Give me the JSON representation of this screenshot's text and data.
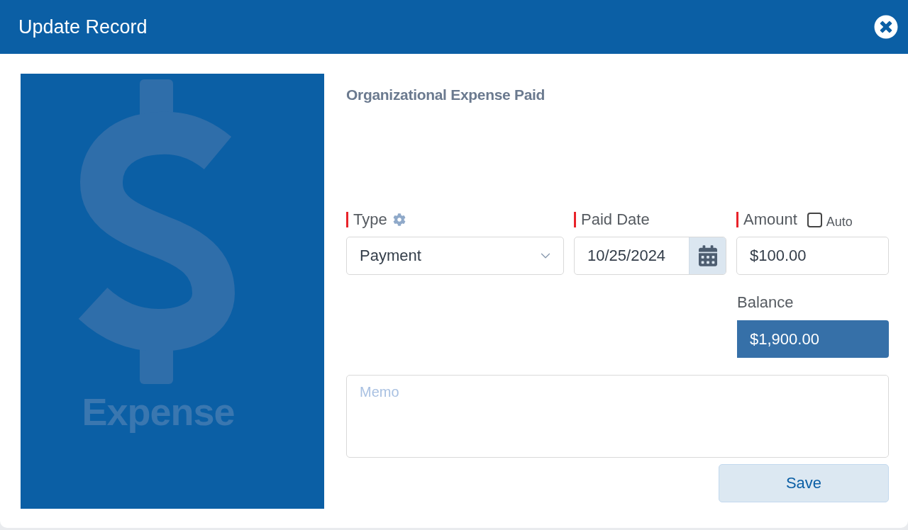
{
  "window": {
    "title": "Update Record"
  },
  "illustration": {
    "caption": "Expense"
  },
  "form": {
    "heading": "Organizational Expense Paid",
    "fields": [
      {
        "kind": "select",
        "label": "Type",
        "required": true,
        "value": "Payment"
      },
      {
        "kind": "date",
        "label": "Paid Date",
        "required": true,
        "value": "10/25/2024"
      },
      {
        "kind": "amount",
        "label": "Amount",
        "required": true,
        "value": "$100.00",
        "auto": {
          "label": "Auto",
          "checked": false
        }
      }
    ],
    "balance": {
      "label": "Balance",
      "value": "$1,900.00"
    },
    "memo": {
      "placeholder": "Memo"
    },
    "buttons": [
      "Save"
    ]
  }
}
